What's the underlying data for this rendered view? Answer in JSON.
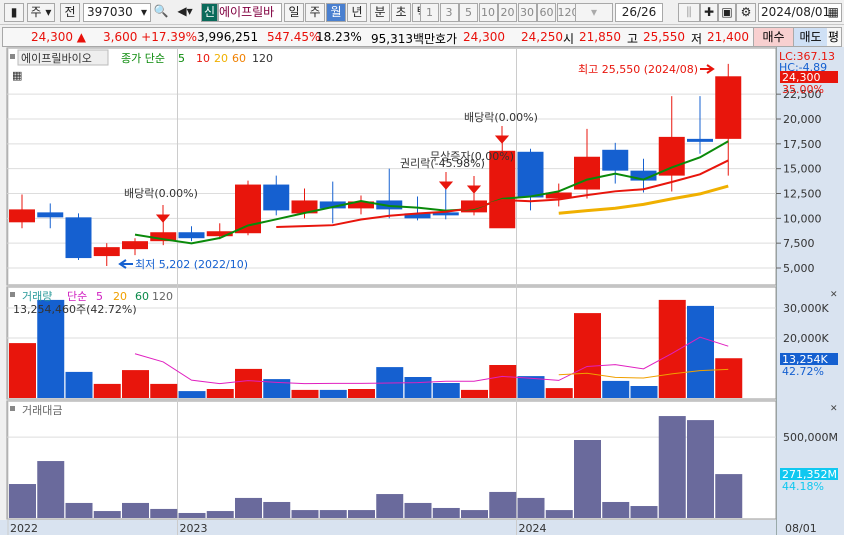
{
  "toolbar": {
    "period_short": "주",
    "mode": "전",
    "code": "397030",
    "new_badge": "신",
    "stock_name": "에이프릴바",
    "tabs": [
      "일",
      "주",
      "월",
      "년",
      "분",
      "초",
      "틱"
    ],
    "active_tab": "월",
    "intervals": [
      "1",
      "3",
      "5",
      "10",
      "20",
      "30",
      "60",
      "120"
    ],
    "count": "26",
    "total": "/26",
    "date": "2024/08/01"
  },
  "quote": {
    "price": "24,300 ▲",
    "change": "3,600 +17.39%",
    "volume": "3,996,251",
    "vol_ratio": "547.45%",
    "turnover": "18.23%",
    "amount": "95,313백만",
    "hoga_label": "호가",
    "ask": "24,300",
    "bid": "24,250",
    "open_label": "시",
    "open": "21,850",
    "high_label": "고",
    "high": "25,550",
    "low_label": "저",
    "low": "21,400",
    "buy": "매수",
    "sell": "매도",
    "extra": "평"
  },
  "price_panel": {
    "name": "에이프릴바이오",
    "ma_label": "종가 단순",
    "ma_periods": [
      "5",
      "10",
      "20",
      "60",
      "120"
    ],
    "lc": "LC:367.13",
    "hc": "HC:-4.89",
    "last": "24,300",
    "last_pct": "35.00%",
    "axis": [
      "22,500",
      "20,000",
      "17,500",
      "15,000",
      "12,500",
      "10,000",
      "7,500",
      "5,000"
    ],
    "high_note": "최고 25,550 (2024/08)",
    "low_note": "최저 5,202 (2022/10)",
    "events": [
      {
        "label": "배당락(0.00%)",
        "idx": 5
      },
      {
        "label": "권리락(-45.98%)",
        "idx": 15
      },
      {
        "label": "무상증자(0.00%)",
        "idx": 16
      },
      {
        "label": "배당락(0.00%)",
        "idx": 17
      }
    ]
  },
  "volume_panel": {
    "name": "거래량",
    "ma_label": "단순",
    "ma_periods": [
      "5",
      "20",
      "60",
      "120"
    ],
    "readout": "13,254,460주(42.72%)",
    "axis": [
      "30,000K",
      "20,000K"
    ],
    "last": "13,254K",
    "last_pct": "42.72%"
  },
  "amount_panel": {
    "name": "거래대금",
    "axis": [
      "500,000M"
    ],
    "last": "271,352M",
    "last_pct": "44.18%"
  },
  "x_axis": {
    "labels": [
      {
        "text": "2022",
        "idx": 0
      },
      {
        "text": "2023",
        "idx": 6
      },
      {
        "text": "2024",
        "idx": 18
      }
    ],
    "right": "08/01"
  },
  "colors": {
    "up": "#e8150c",
    "down": "#1560d0",
    "amount": "#6a6a9c"
  },
  "chart_data": {
    "type": "candlestick",
    "x": [
      "2022/07",
      "2022/08",
      "2022/09",
      "2022/10",
      "2022/11",
      "2022/12",
      "2023/01",
      "2023/02",
      "2023/03",
      "2023/04",
      "2023/05",
      "2023/06",
      "2023/07",
      "2023/08",
      "2023/09",
      "2023/10",
      "2023/11",
      "2023/12",
      "2024/01",
      "2024/02",
      "2024/03",
      "2024/04",
      "2024/05",
      "2024/06",
      "2024/07",
      "2024/08"
    ],
    "open": [
      9600,
      10600,
      10100,
      6200,
      6900,
      7700,
      8600,
      8200,
      8500,
      13400,
      10500,
      11700,
      11000,
      11800,
      10500,
      10600,
      10600,
      9000,
      16700,
      12000,
      12900,
      16900,
      14800,
      14300,
      18000,
      18000
    ],
    "high": [
      12400,
      11500,
      10500,
      7500,
      8000,
      10000,
      9200,
      9500,
      13800,
      14300,
      13000,
      13700,
      12300,
      15000,
      12200,
      13000,
      12500,
      18000,
      17000,
      13500,
      19000,
      17600,
      16000,
      22300,
      22300,
      25550
    ],
    "low": [
      9000,
      9000,
      5800,
      5202,
      6300,
      7300,
      7700,
      7900,
      8300,
      10300,
      10000,
      9500,
      10400,
      10000,
      9800,
      9900,
      10300,
      10800,
      10800,
      11200,
      12000,
      13500,
      12600,
      12700,
      16500,
      14300
    ],
    "close": [
      10900,
      10100,
      6000,
      7100,
      7700,
      8600,
      8000,
      8700,
      13400,
      10800,
      11800,
      11000,
      11700,
      10900,
      10000,
      10300,
      11800,
      16800,
      12100,
      12600,
      16200,
      14800,
      13800,
      18200,
      17700,
      24300
    ],
    "volume_k": [
      18300,
      32700,
      8700,
      4700,
      9300,
      4700,
      2300,
      3000,
      9700,
      6300,
      2700,
      2700,
      3000,
      10300,
      7000,
      5000,
      2700,
      11000,
      7300,
      3300,
      28300,
      5700,
      4000,
      32700,
      30700,
      13254
    ],
    "amount_m": [
      210000,
      352000,
      93000,
      43000,
      93000,
      56000,
      31000,
      43000,
      124000,
      99000,
      49000,
      49000,
      49000,
      148000,
      93000,
      62000,
      49000,
      161000,
      124000,
      49000,
      482000,
      99000,
      74000,
      630000,
      605000,
      271352
    ]
  }
}
